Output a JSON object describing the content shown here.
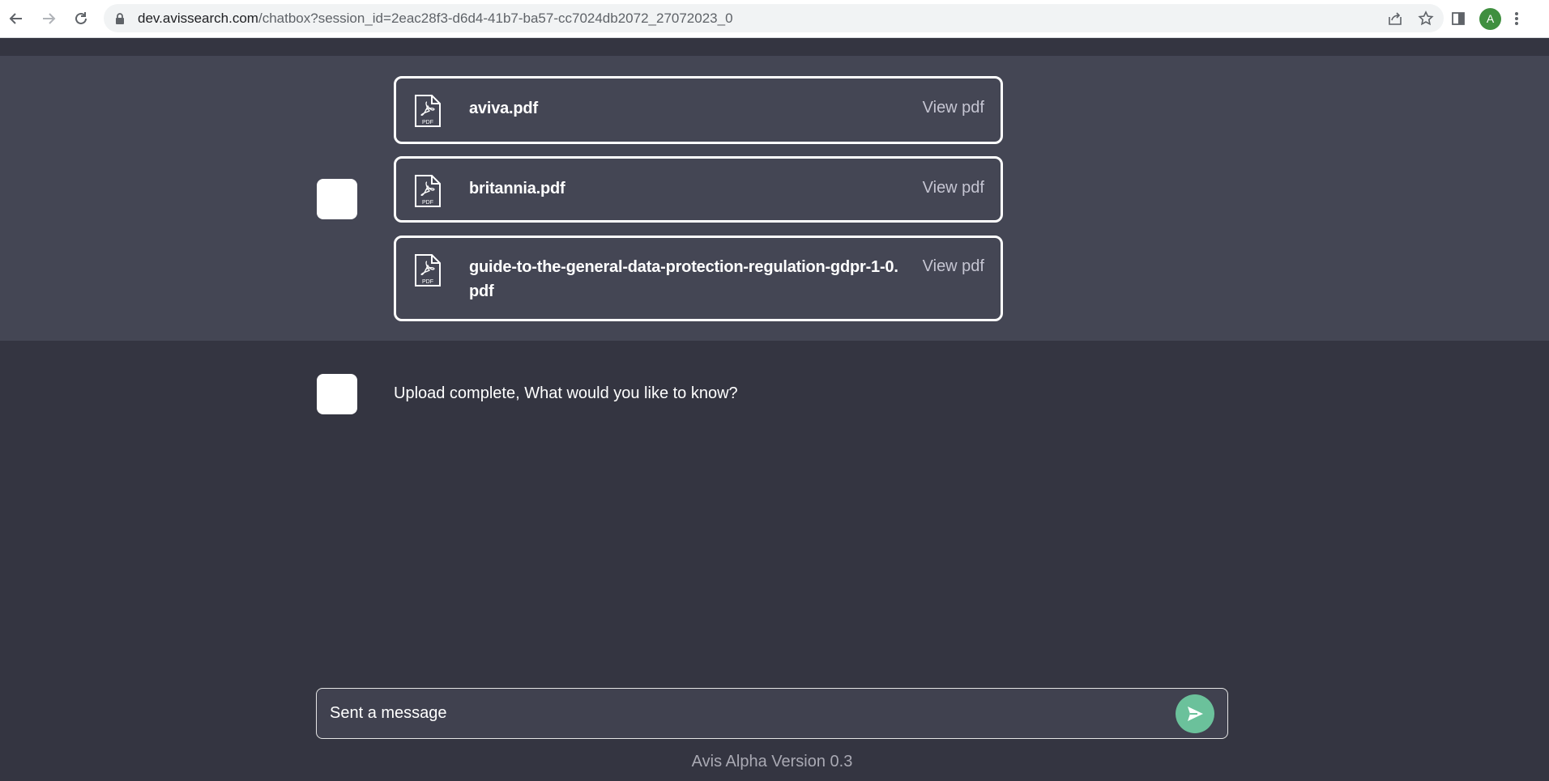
{
  "browser": {
    "url_domain": "dev.avissearch.com",
    "url_path": "/chatbox?session_id=2eac28f3-d6d4-41b7-ba57-cc7024db2072_27072023_0",
    "profile_initial": "A"
  },
  "files": [
    {
      "name": "aviva.pdf",
      "view_label": "View pdf",
      "icon_label": "PDF"
    },
    {
      "name": "britannia.pdf",
      "view_label": "View pdf",
      "icon_label": "PDF"
    },
    {
      "name": "guide-to-the-general-data-protection-regulation-gdpr-1-0.pdf",
      "view_label": "View pdf",
      "icon_label": "PDF"
    }
  ],
  "message": {
    "text": "Upload complete, What would you like to know?"
  },
  "composer": {
    "placeholder": "Sent a message"
  },
  "footer": {
    "version": "Avis Alpha Version 0.3"
  },
  "colors": {
    "background": "#343541",
    "files_panel": "#444654",
    "send_button": "#6bc19b"
  }
}
